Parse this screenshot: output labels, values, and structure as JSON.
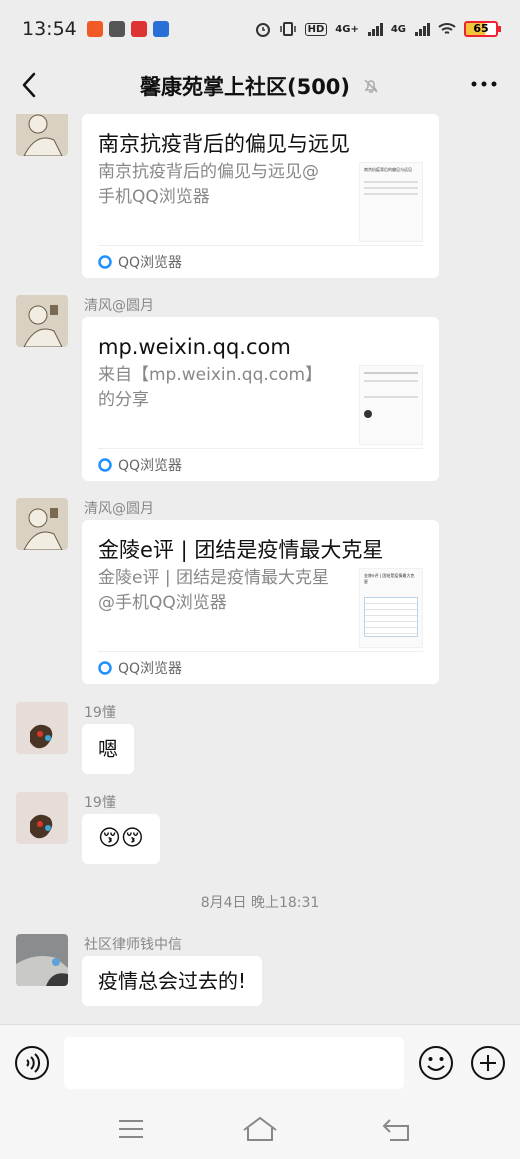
{
  "status_bar": {
    "time": "13:54",
    "network_labels": [
      "HD",
      "4G+",
      "4G"
    ],
    "battery": "65"
  },
  "header": {
    "title": "馨康苑掌上社区(500)"
  },
  "messages": [
    {
      "type": "card",
      "sender": "",
      "card_title": "南京抗疫背后的偏见与远见",
      "card_desc": "南京抗疫背后的偏见与远见@手机QQ浏览器",
      "thumb_title": "南京抗疫背后的偏见与远见",
      "source": "QQ浏览器"
    },
    {
      "type": "card",
      "sender": "清风@圆月",
      "card_title": "mp.weixin.qq.com",
      "card_desc": "来自【mp.weixin.qq.com】的分享",
      "thumb_title": "",
      "source": "QQ浏览器"
    },
    {
      "type": "card",
      "sender": "清风@圆月",
      "card_title": "金陵e评 | 团结是疫情最大克星",
      "card_desc": "金陵e评 | 团结是疫情最大克星@手机QQ浏览器",
      "thumb_title": "金陵e评 | 团结是疫情最大克星",
      "source": "QQ浏览器"
    },
    {
      "type": "text",
      "sender": "19懂",
      "text": "嗯"
    },
    {
      "type": "text",
      "sender": "19懂",
      "text": "😚😚"
    },
    {
      "type": "timestamp",
      "text": "8月4日 晚上18:31"
    },
    {
      "type": "text",
      "sender": "社区律师钱中信",
      "text": "疫情总会过去的!"
    }
  ],
  "input": {
    "placeholder": ""
  },
  "colors": {
    "background": "#ededed",
    "bubble": "#ffffff",
    "meta_text": "#888888",
    "qq_blue": "#1e90ff"
  }
}
